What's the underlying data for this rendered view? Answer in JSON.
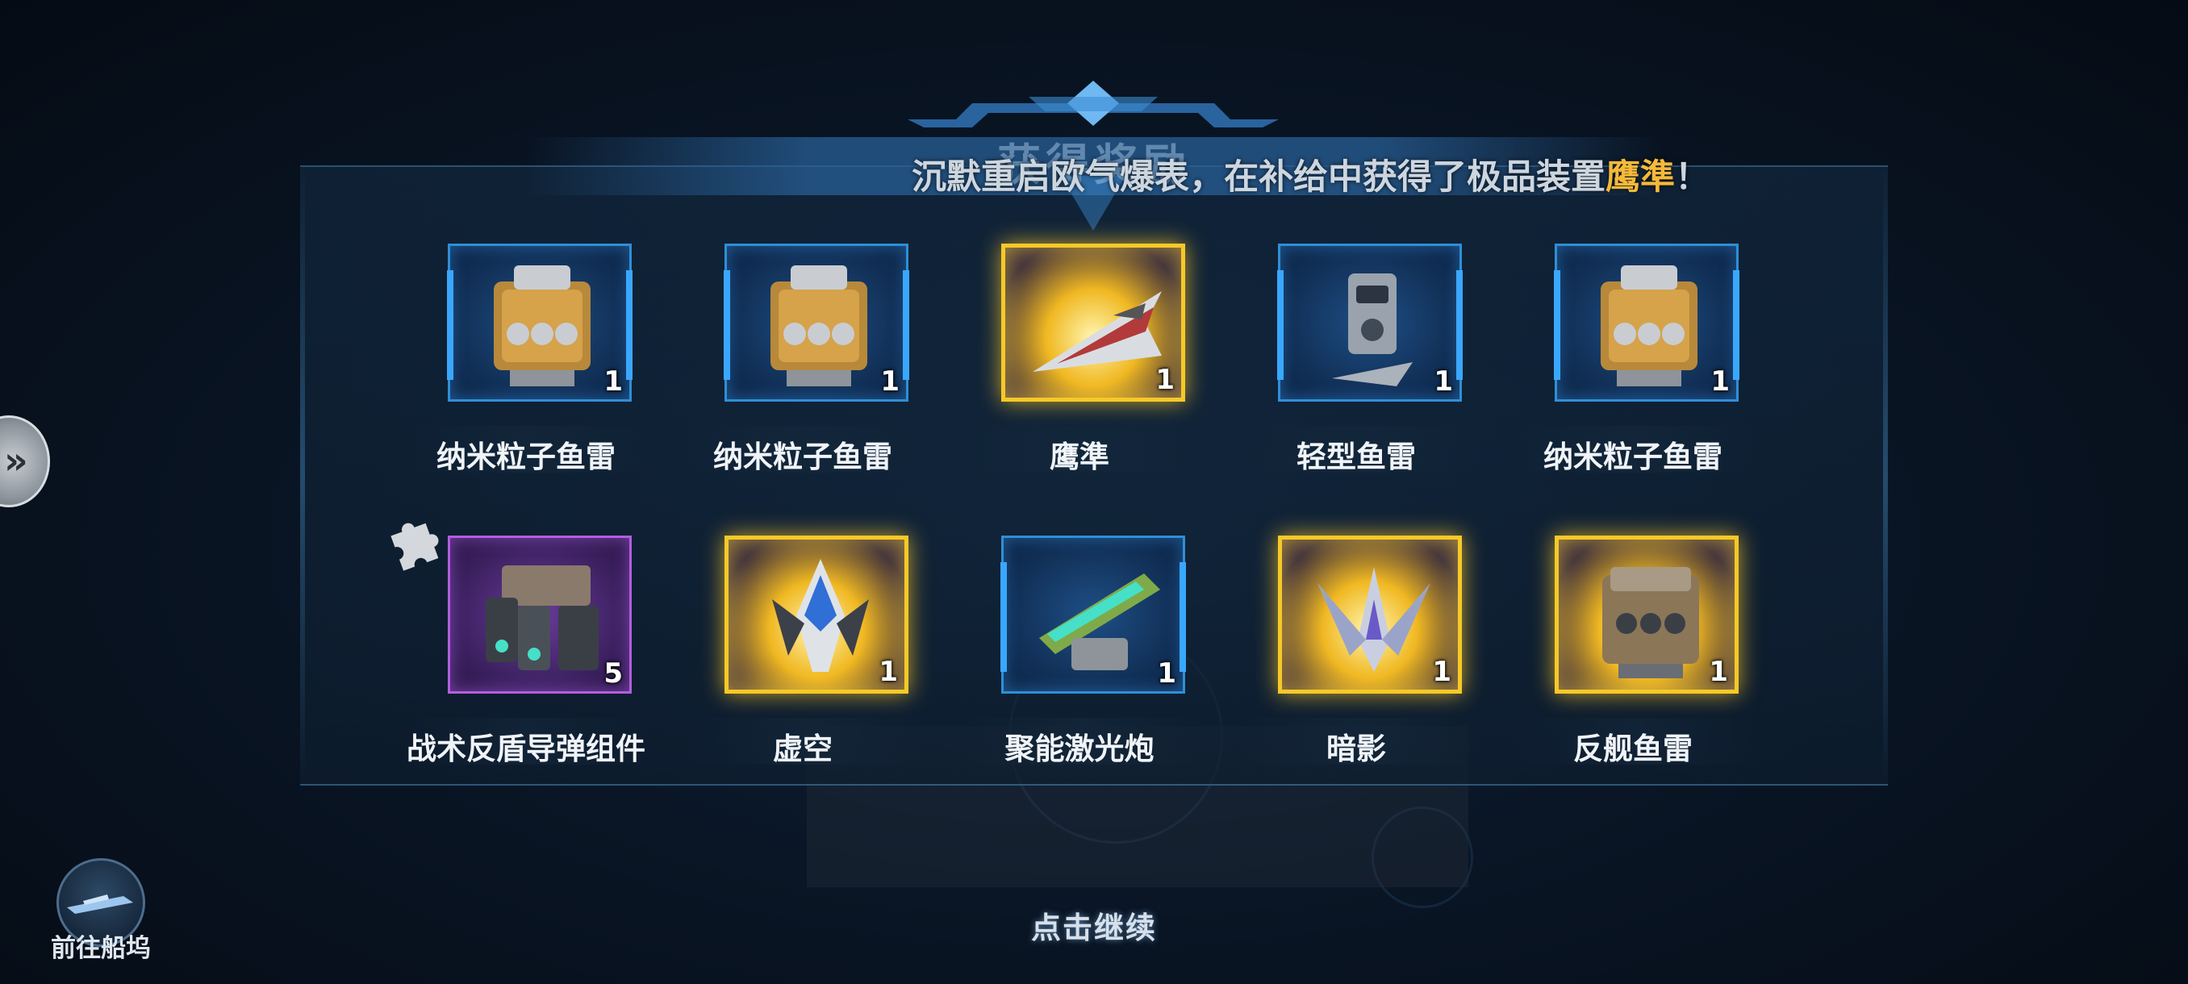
{
  "header": {
    "title": "获得奖励",
    "announcement_prefix": "沉默重启欧气爆表，在补给中获得了极品装置",
    "announcement_highlight": "鹰準",
    "announcement_suffix": "！"
  },
  "items": [
    {
      "name": "纳米粒子鱼雷",
      "count": "1",
      "rarity": "blue",
      "icon": "nano-torpedo-icon"
    },
    {
      "name": "纳米粒子鱼雷",
      "count": "1",
      "rarity": "blue",
      "icon": "nano-torpedo-icon"
    },
    {
      "name": "鹰準",
      "count": "1",
      "rarity": "gold",
      "icon": "fighter-ship-icon"
    },
    {
      "name": "轻型鱼雷",
      "count": "1",
      "rarity": "blue",
      "icon": "light-torpedo-icon"
    },
    {
      "name": "纳米粒子鱼雷",
      "count": "1",
      "rarity": "blue",
      "icon": "nano-torpedo-icon"
    },
    {
      "name": "战术反盾导弹组件",
      "count": "5",
      "rarity": "purple",
      "icon": "missile-launcher-icon"
    },
    {
      "name": "虚空",
      "count": "1",
      "rarity": "gold",
      "icon": "void-ship-icon"
    },
    {
      "name": "聚能激光炮",
      "count": "1",
      "rarity": "blue",
      "icon": "laser-cannon-icon"
    },
    {
      "name": "暗影",
      "count": "1",
      "rarity": "gold",
      "icon": "shadow-ship-icon"
    },
    {
      "name": "反舰鱼雷",
      "count": "1",
      "rarity": "gold",
      "icon": "anti-ship-torpedo-icon"
    }
  ],
  "footer": {
    "continue_label": "点击继续",
    "dock_label": "前往船坞"
  },
  "colors": {
    "highlight": "#f5b93a",
    "blue_frame": "#2f8fd6",
    "gold_frame": "#f6c928",
    "purple_frame": "#b45de0"
  }
}
